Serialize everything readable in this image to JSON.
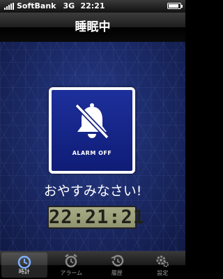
{
  "status_bar": {
    "carrier": "SoftBank",
    "network": "3G",
    "time": "22:21",
    "battery_level": 0.85
  },
  "header": {
    "title": "睡眠中"
  },
  "alarm": {
    "icon": "bell-slash-icon",
    "label": "ALARM OFF"
  },
  "message": "おやすみなさい!",
  "clock": {
    "time": "22:21:21"
  },
  "tabs": [
    {
      "label": "時計",
      "icon": "clock-icon",
      "active": true
    },
    {
      "label": "アラーム",
      "icon": "alarm-clock-icon",
      "active": false
    },
    {
      "label": "履歴",
      "icon": "history-icon",
      "active": false
    },
    {
      "label": "設定",
      "icon": "gear-icon",
      "active": false
    }
  ],
  "colors": {
    "accent_blue": "#1d2f9b",
    "background_blue": "#1c2b6a",
    "lcd_green": "#a9ad86"
  }
}
